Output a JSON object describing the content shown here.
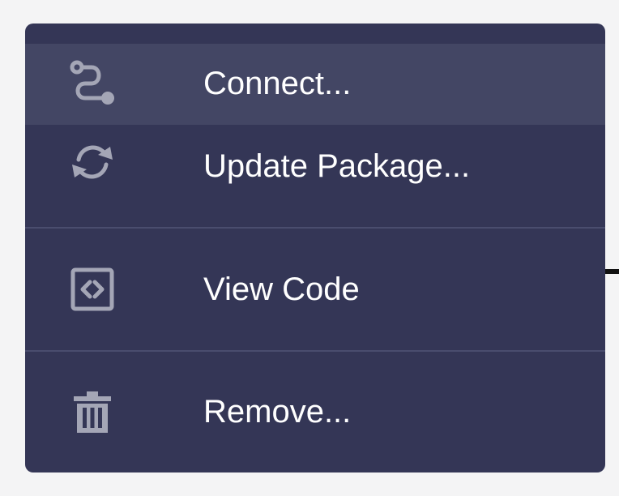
{
  "menu": {
    "items": [
      {
        "label": "Connect...",
        "icon": "connect-icon",
        "active": true
      },
      {
        "label": "Update Package...",
        "icon": "refresh-icon",
        "active": false
      },
      {
        "label": "View Code",
        "icon": "code-icon",
        "active": false
      },
      {
        "label": "Remove...",
        "icon": "trash-icon",
        "active": false
      }
    ]
  },
  "colors": {
    "menu_background": "#343656",
    "active_background": "#434664",
    "icon_color": "#a4a6b6",
    "text_color": "#ffffff",
    "divider_color": "#4a4d6e"
  }
}
